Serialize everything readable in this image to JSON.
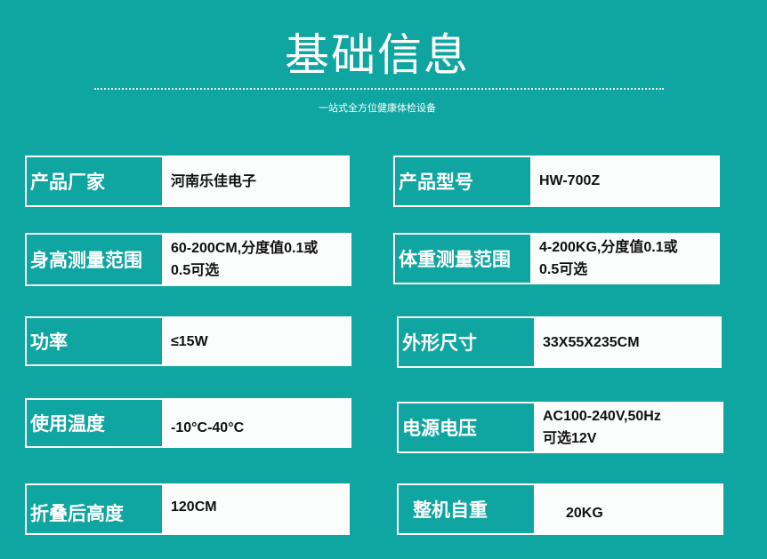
{
  "header": {
    "title": "基础信息",
    "subtitle": "一站式全方位健康体检设备"
  },
  "specs": [
    {
      "label": "产品厂家",
      "value": "河南乐佳电子"
    },
    {
      "label": "产品型号",
      "value": "HW-700Z"
    },
    {
      "label": "身高测量范围",
      "value": "60-200CM,分度值0.1或\n0.5可选"
    },
    {
      "label": "体重测量范围",
      "value": "4-200KG,分度值0.1或\n0.5可选"
    },
    {
      "label": "功率",
      "value": "≤15W"
    },
    {
      "label": "外形尺寸",
      "value": "33X55X235CM"
    },
    {
      "label": "使用温度",
      "value": "-10°C-40°C"
    },
    {
      "label": "电源电压",
      "value": "AC100-240V,50Hz\n可选12V"
    },
    {
      "label": "折叠后高度",
      "value": "120CM"
    },
    {
      "label": "整机自重",
      "value": "20KG"
    }
  ],
  "colors": {
    "background": "#0fa5a1",
    "panel": "#fbfcfc",
    "text": "#111111"
  }
}
